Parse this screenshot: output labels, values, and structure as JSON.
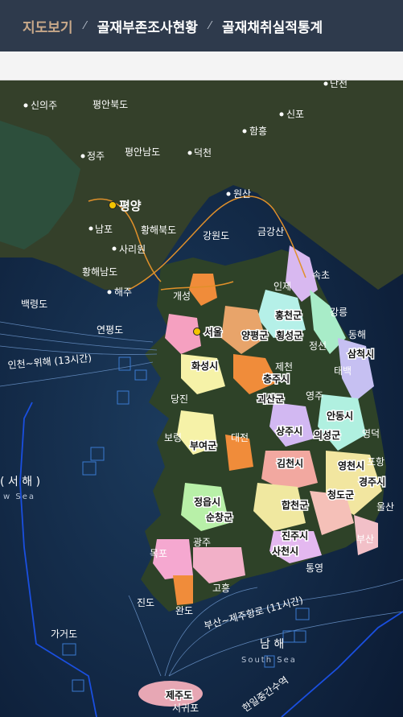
{
  "tabs": [
    {
      "label": "지도보기",
      "active": true
    },
    {
      "label": "골재부존조사현황",
      "active": false
    },
    {
      "label": "골재채취실적통계",
      "active": false
    }
  ],
  "separator": "⁄",
  "map": {
    "north_labels": [
      "신의주",
      "평안북도",
      "정주",
      "평안남도",
      "덕천",
      "평양",
      "남포",
      "황해북도",
      "사리원",
      "황해남도",
      "해주",
      "개성",
      "원산",
      "금강산",
      "강원도",
      "함흥",
      "신포",
      "단천",
      "백령도",
      "연평도"
    ],
    "district_labels": [
      "홍천군",
      "양평군",
      "횡성군",
      "서울",
      "화성시",
      "충주시",
      "괴산군",
      "삼척시",
      "동해",
      "상주시",
      "안동시",
      "의성군",
      "부여군",
      "대전",
      "김천시",
      "영천시",
      "경주시",
      "정읍시",
      "순창군",
      "합천군",
      "청도군",
      "진주시",
      "사천시",
      "광주",
      "목포",
      "완도",
      "진도",
      "제주도",
      "서귀포",
      "속초",
      "강릉",
      "인제",
      "포항",
      "영덕",
      "부산",
      "통영",
      "고흥",
      "태백",
      "정선",
      "제천",
      "영주",
      "당진",
      "보령",
      "울산"
    ],
    "sea_west": "( 서 해 )",
    "sea_west_en": "w Sea",
    "sea_south": "남 해",
    "sea_south_en": "South Sea",
    "island_label": "가거도",
    "boundary_label": "한일중간수역",
    "route_label": "부산~제주항로 (11시간)",
    "ferry_label": "인천~위해 (13시간)"
  }
}
